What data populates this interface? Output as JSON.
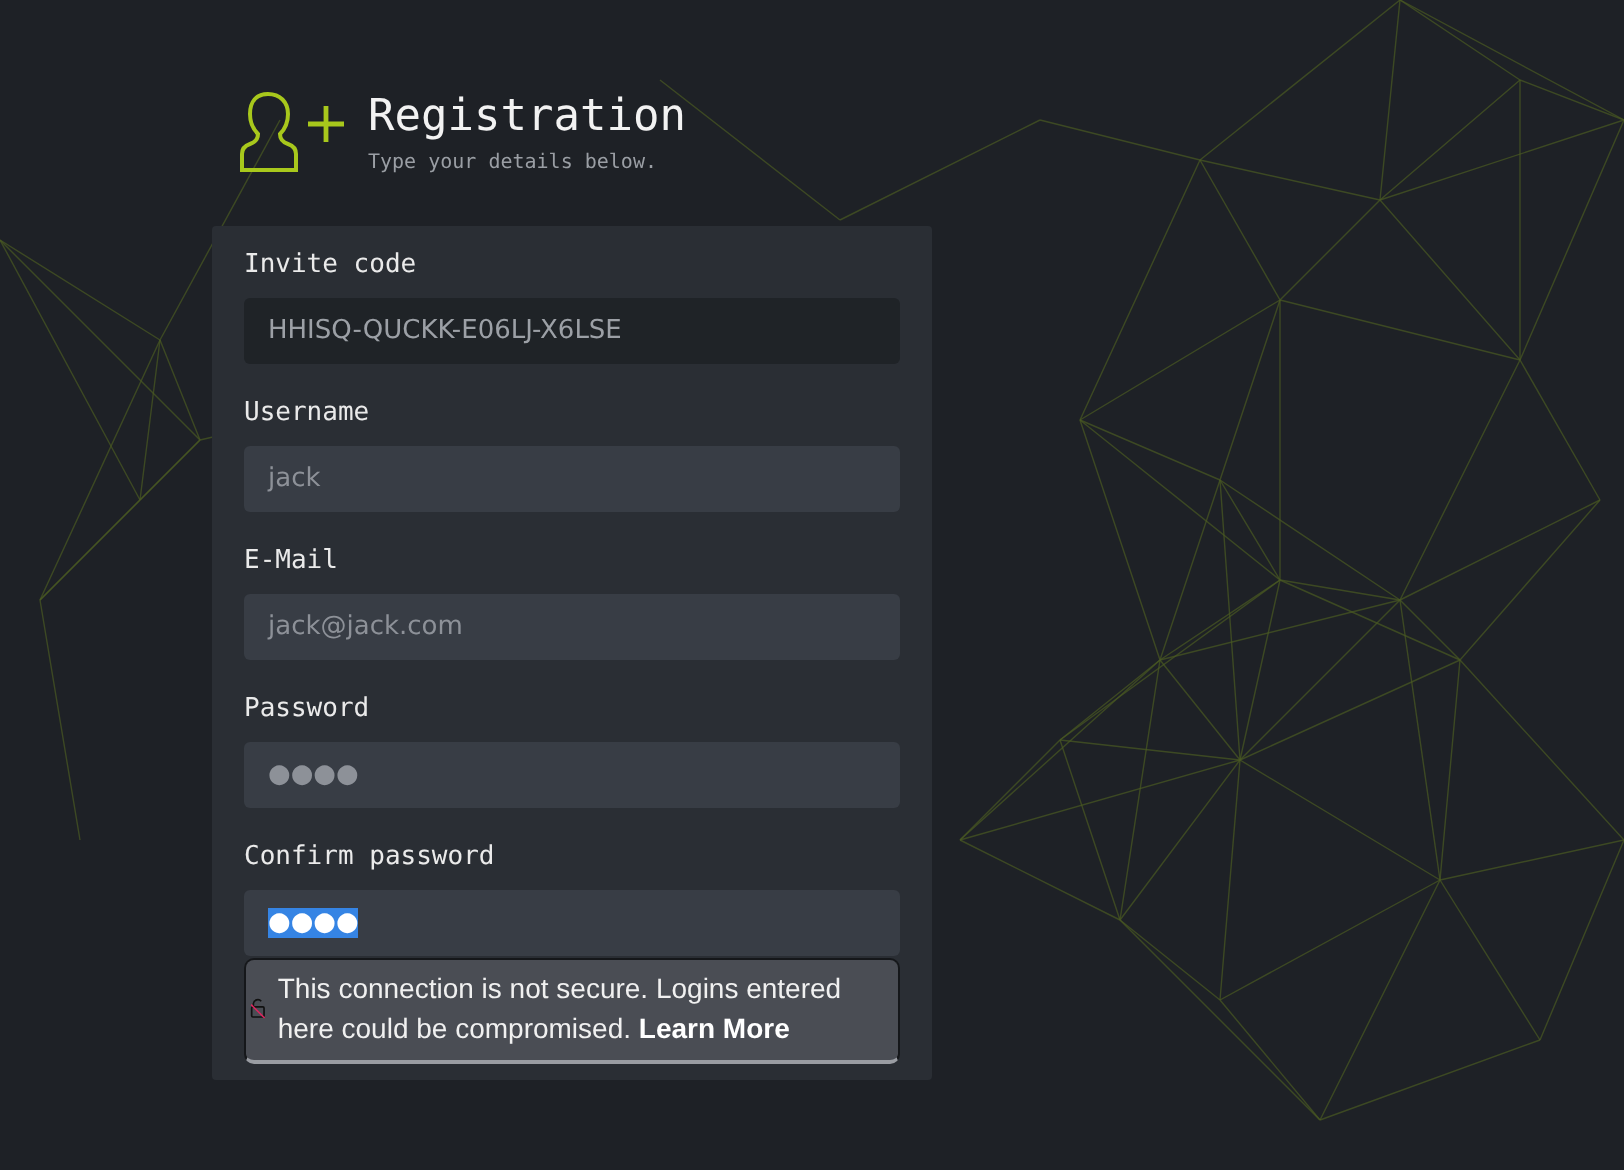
{
  "header": {
    "title": "Registration",
    "subtitle": "Type your details below."
  },
  "fields": [
    {
      "label": "Invite code",
      "value": "HHISQ-QUCKK-E06LJ-X6LSE",
      "readonly": true,
      "text_selected": false
    },
    {
      "label": "Username",
      "value": "jack",
      "readonly": false,
      "text_selected": false
    },
    {
      "label": "E-Mail",
      "value": "jack@jack.com",
      "readonly": false,
      "text_selected": false
    },
    {
      "label": "Password",
      "value": "●●●●",
      "readonly": false,
      "text_selected": false
    },
    {
      "label": "Confirm password",
      "value": "●●●●",
      "readonly": false,
      "text_selected": true
    }
  ],
  "security_popup": {
    "message": "This connection is not secure. Logins entered here could be compromised.",
    "link": "Learn More"
  }
}
